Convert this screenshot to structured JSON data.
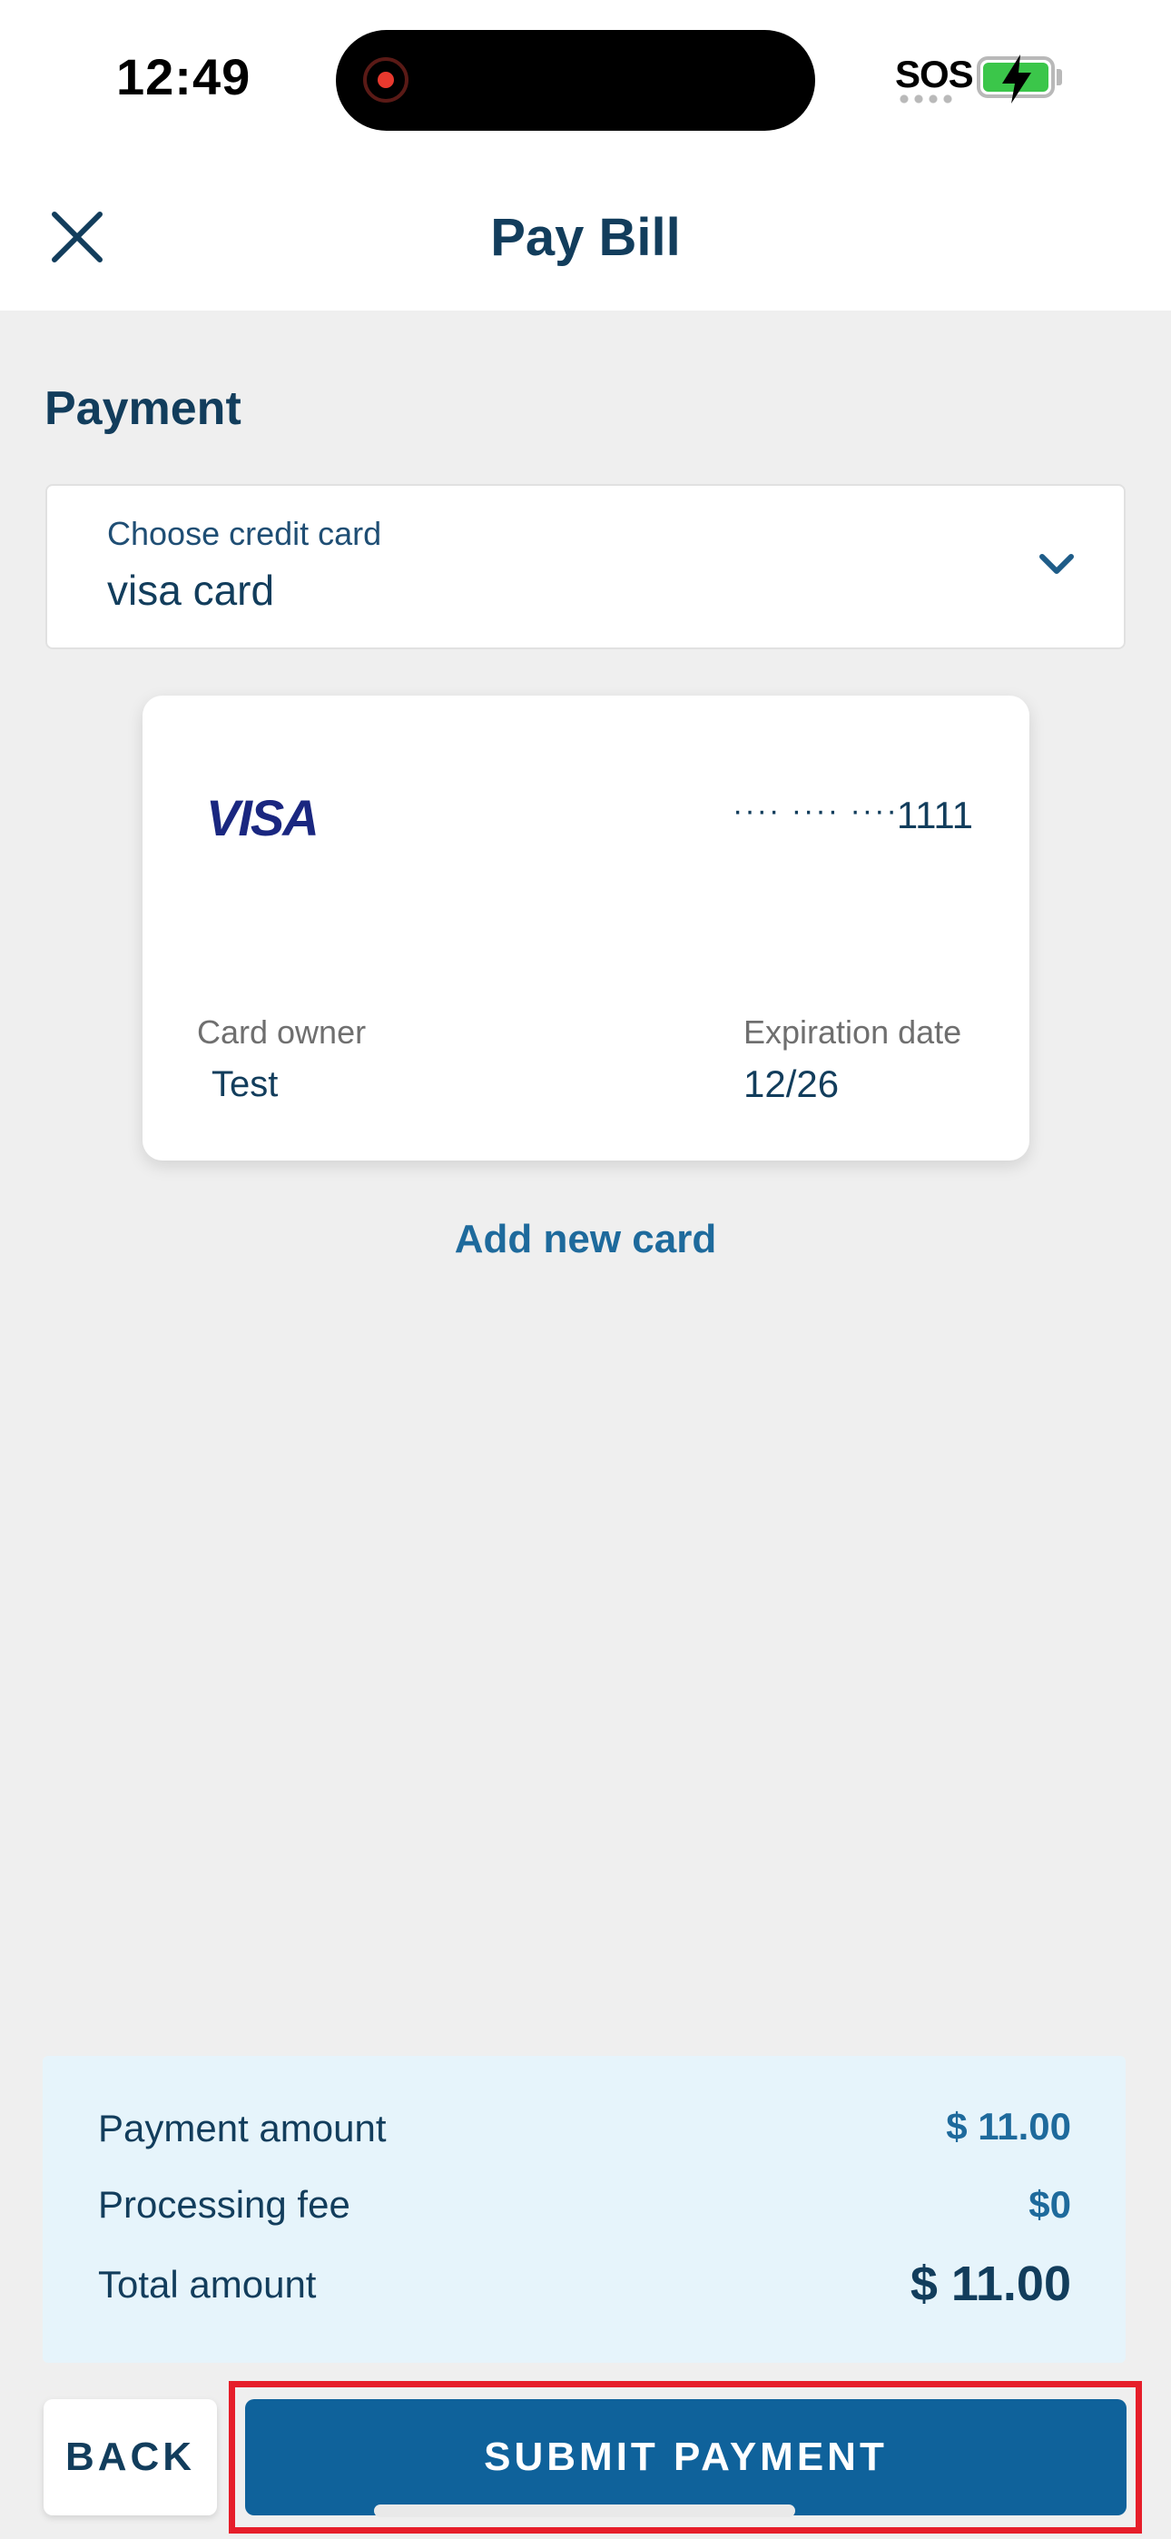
{
  "status_bar": {
    "time": "12:49",
    "carrier": "SOS",
    "battery_charging": true,
    "battery_color": "#3bc64a",
    "recording_indicator_color": "#e8392e"
  },
  "header": {
    "title": "Pay Bill",
    "close_icon": "close-icon"
  },
  "payment": {
    "section_title": "Payment",
    "card_select": {
      "label": "Choose credit card",
      "value": "visa card",
      "icon": "chevron-down-icon"
    },
    "card": {
      "brand": "VISA",
      "masked_digits": "···· ···· ····",
      "last4": "1111",
      "owner_label": "Card owner",
      "owner_value": "Test",
      "expiration_label": "Expiration date",
      "expiration_value": "12/26"
    },
    "add_card_label": "Add new card"
  },
  "summary": {
    "rows": [
      {
        "label": "Payment amount",
        "value": "$ 11.00"
      },
      {
        "label": "Processing fee",
        "value": "$0"
      },
      {
        "label": "Total amount",
        "value": "$ 11.00"
      }
    ]
  },
  "actions": {
    "back_label": "BACK",
    "submit_label": "SUBMIT PAYMENT"
  },
  "colors": {
    "primary": "#0f629b",
    "text": "#123d5c",
    "link": "#1e6a9c",
    "summary_bg": "#e6f4fb",
    "highlight": "#e61e2a"
  }
}
